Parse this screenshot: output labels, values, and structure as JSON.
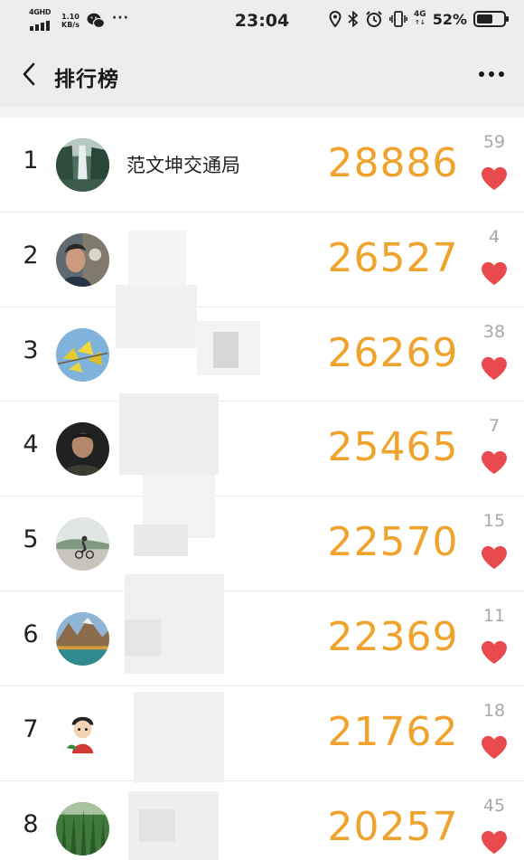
{
  "status_bar": {
    "network_type": "4GHD",
    "speed_value": "1.10",
    "speed_unit": "KB/s",
    "more": "···",
    "time": "23:04",
    "cell_type": "4G",
    "battery_percent": "52%",
    "battery_level": 0.52,
    "icons": [
      "signal-icon",
      "wechat-icon",
      "location-icon",
      "bluetooth-icon",
      "alarm-icon",
      "vibrate-icon",
      "battery-icon"
    ]
  },
  "nav": {
    "back_icon": "chevron-left-icon",
    "title": "排行榜",
    "more_icon": "more-icon"
  },
  "colors": {
    "score": "#f0a32c",
    "heart": "#e94a4e",
    "likes": "#a8a8a8",
    "header_bg": "#ededed"
  },
  "ranking": [
    {
      "rank": "1",
      "name": "范文坤交通局",
      "score": "28886",
      "likes": "59",
      "avatar": "waterfall"
    },
    {
      "rank": "2",
      "name": "",
      "score": "26527",
      "likes": "4",
      "avatar": "person-selfie"
    },
    {
      "rank": "3",
      "name": "",
      "score": "26269",
      "likes": "38",
      "avatar": "ginkgo-leaves"
    },
    {
      "rank": "4",
      "name": "",
      "score": "25465",
      "likes": "7",
      "avatar": "man-portrait"
    },
    {
      "rank": "5",
      "name": "",
      "score": "22570",
      "likes": "15",
      "avatar": "cyclist-road"
    },
    {
      "rank": "6",
      "name": "",
      "score": "22369",
      "likes": "11",
      "avatar": "mountain-lake"
    },
    {
      "rank": "7",
      "name": "",
      "score": "21762",
      "likes": "18",
      "avatar": "cartoon-character"
    },
    {
      "rank": "8",
      "name": "",
      "score": "20257",
      "likes": "45",
      "avatar": "green-plants"
    }
  ]
}
